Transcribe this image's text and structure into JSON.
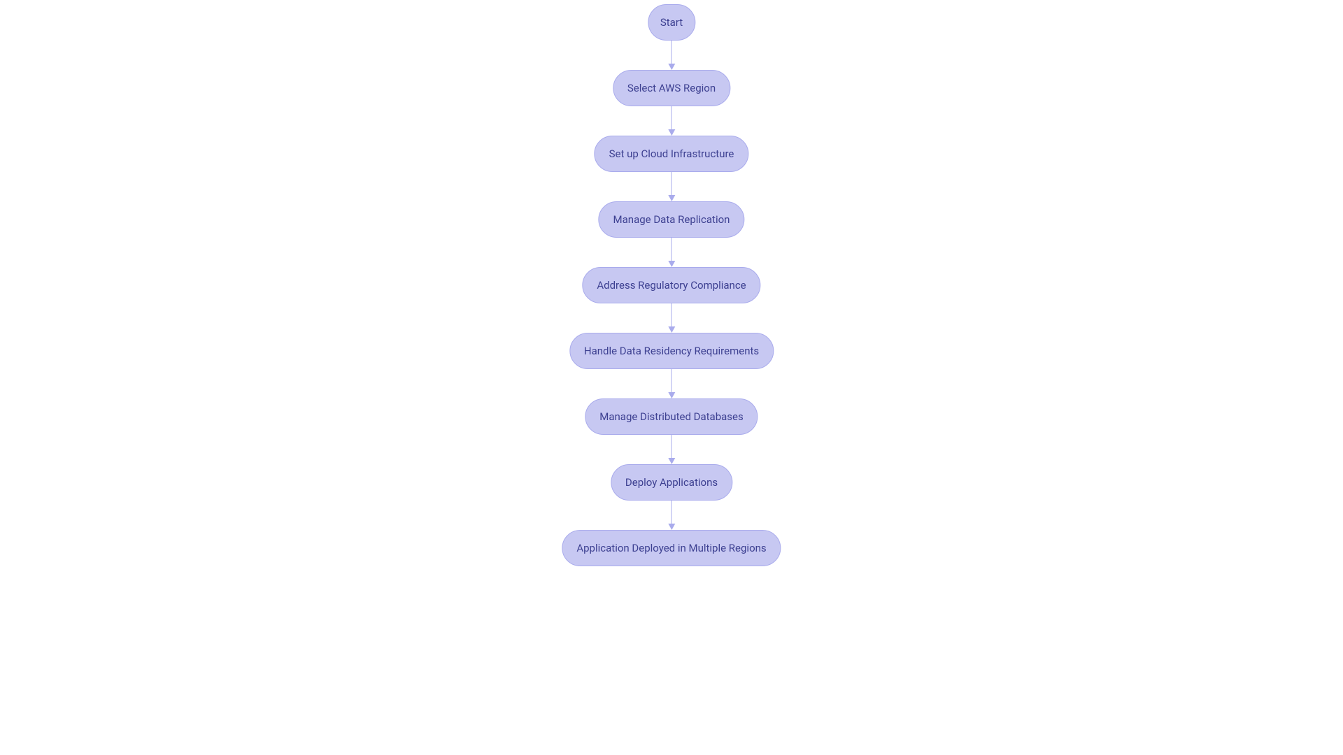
{
  "colors": {
    "node_fill": "#c7c8f2",
    "node_border": "#a9abec",
    "text": "#3d4091",
    "arrow": "#a9abec"
  },
  "nodes": [
    {
      "label": "Start"
    },
    {
      "label": "Select AWS Region"
    },
    {
      "label": "Set up Cloud Infrastructure"
    },
    {
      "label": "Manage Data Replication"
    },
    {
      "label": "Address Regulatory Compliance"
    },
    {
      "label": "Handle Data Residency Requirements"
    },
    {
      "label": "Manage Distributed Databases"
    },
    {
      "label": "Deploy Applications"
    },
    {
      "label": "Application Deployed in Multiple Regions"
    }
  ]
}
